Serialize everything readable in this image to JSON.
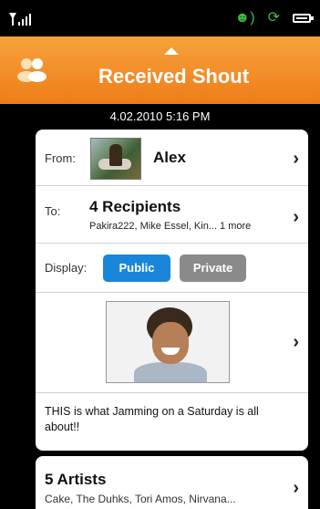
{
  "status": {
    "icons": [
      "signal-icon",
      "headset-icon",
      "sync-icon",
      "battery-icon"
    ]
  },
  "header": {
    "title": "Received Shout",
    "logo_icon": "people-icon"
  },
  "shout": {
    "datetime": "4.02.2010 5:16 PM",
    "from_label": "From:",
    "from_name": "Alex",
    "to_label": "To:",
    "recipients_count": "4 Recipients",
    "recipients_names": "Pakira222, Mike Essel, Kin... 1 more",
    "display_label": "Display:",
    "public_label": "Public",
    "private_label": "Private",
    "message": "THIS is what Jamming on a Saturday is all about!!"
  },
  "artists": {
    "heading": "5 Artists",
    "list": "Cake, The Duhks, Tori Amos, Nirvana..."
  },
  "colors": {
    "accent": "#ef7d18",
    "public": "#1a86d9",
    "private": "#8a8a8a"
  }
}
